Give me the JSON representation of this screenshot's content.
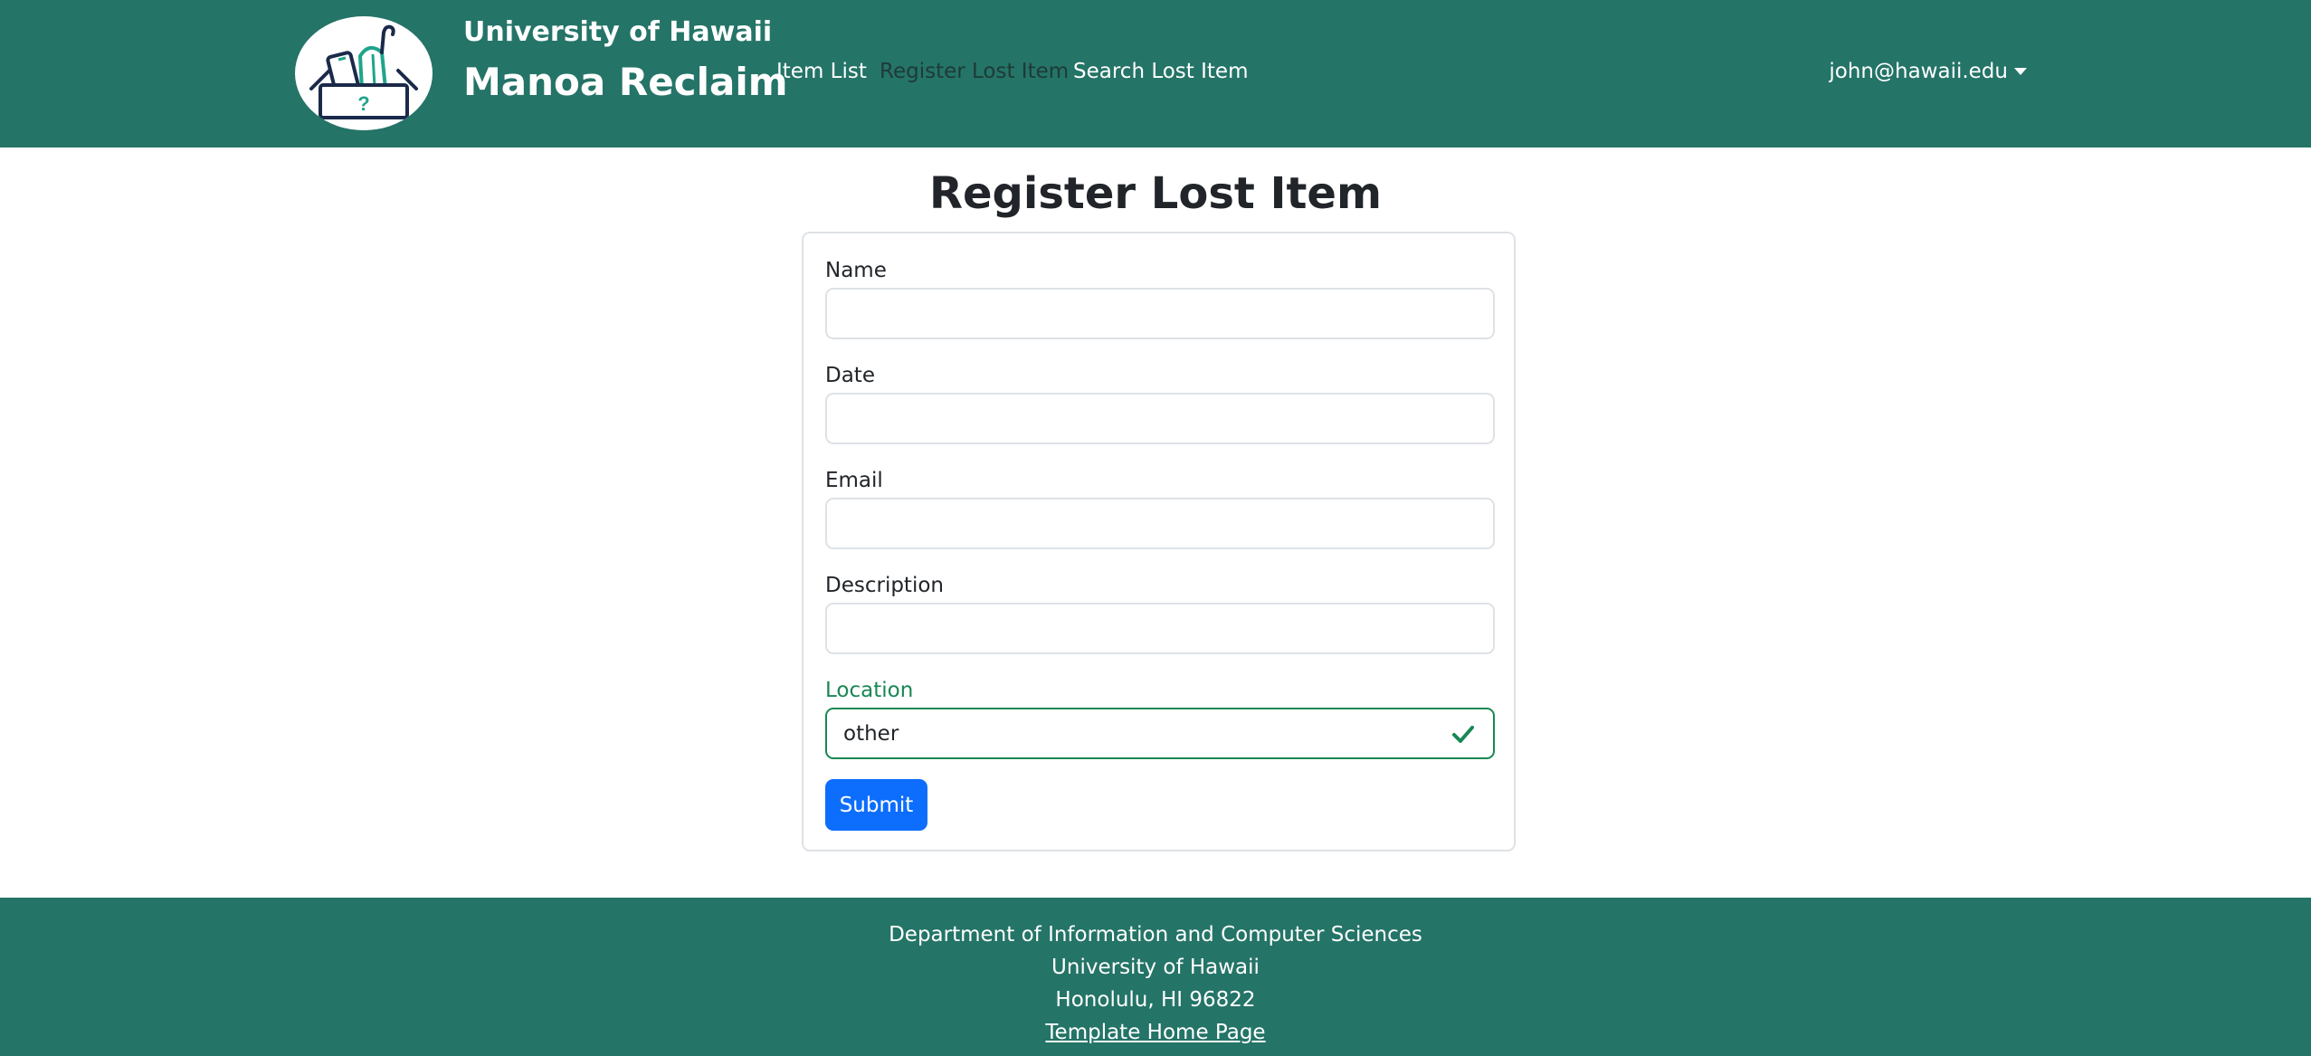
{
  "colors": {
    "navbar_bg": "#247467",
    "primary_button": "#0d6efd",
    "valid_green": "#198754",
    "logo_teal": "#1fa58b",
    "logo_navy": "#1b2a4a"
  },
  "header": {
    "brand_top": "University of Hawaii",
    "brand_main": "Manoa Reclaim",
    "logo_icon": "lost-and-found-box-logo",
    "nav": [
      {
        "label": "Item List",
        "active": false
      },
      {
        "label": "Register Lost Item",
        "active": true
      },
      {
        "label": "Search Lost Item",
        "active": false
      }
    ],
    "user_email": "john@hawaii.edu"
  },
  "main": {
    "title": "Register Lost Item",
    "fields": [
      {
        "label": "Name",
        "value": "",
        "placeholder": ""
      },
      {
        "label": "Date",
        "value": "",
        "placeholder": ""
      },
      {
        "label": "Email",
        "value": "",
        "placeholder": ""
      },
      {
        "label": "Description",
        "value": "",
        "placeholder": ""
      },
      {
        "label": "Location",
        "value": "other",
        "placeholder": "",
        "validated": true
      }
    ],
    "submit_label": "Submit"
  },
  "footer": {
    "line1": "Department of Information and Computer Sciences",
    "line2": "University of Hawaii",
    "line3": "Honolulu, HI 96822",
    "link": "Template Home Page"
  }
}
